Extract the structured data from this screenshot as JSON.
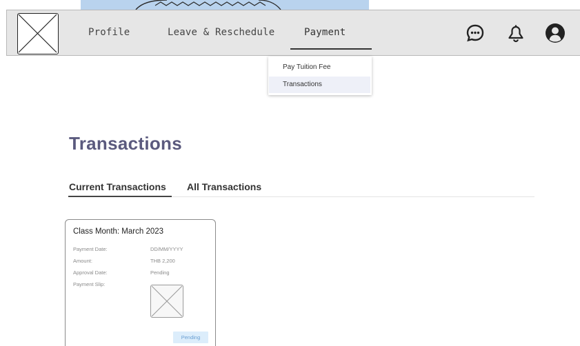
{
  "nav": {
    "items": [
      {
        "label": "Profile"
      },
      {
        "label": "Leave & Reschedule"
      },
      {
        "label": "Payment"
      }
    ],
    "icons": [
      "chat-icon",
      "bell-icon",
      "user-icon"
    ]
  },
  "dropdown": {
    "items": [
      {
        "label": "Pay Tuition Fee"
      },
      {
        "label": "Transactions"
      }
    ]
  },
  "page": {
    "title": "Transactions"
  },
  "tabs": [
    {
      "label": "Current Transactions"
    },
    {
      "label": "All Transactions"
    }
  ],
  "card": {
    "title": "Class Month: March 2023",
    "rows": [
      {
        "label": "Payment Date:",
        "value": "DD/MM/YYYY"
      },
      {
        "label": "Amount:",
        "value": "THB 2,200"
      },
      {
        "label": "Approval Date:",
        "value": "Pending"
      },
      {
        "label": "Payment Slip:"
      }
    ],
    "status": "Pending"
  },
  "colors": {
    "title": "#5b5a7e",
    "banner": "#b9d3ee",
    "navbar": "#e6e6e6",
    "badge_bg": "#dcedfb",
    "badge_text": "#6a9fd2"
  }
}
